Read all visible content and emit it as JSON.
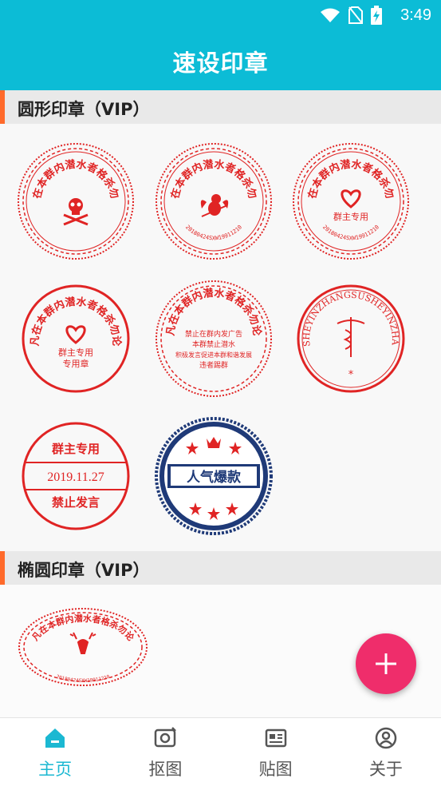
{
  "status_bar": {
    "time": "3:49"
  },
  "app_bar": {
    "title": "速设印章"
  },
  "sections": {
    "round": {
      "label": "圆形印章（VIP）"
    },
    "oval": {
      "label": "椭圆印章（VIP）"
    }
  },
  "stamps": {
    "s1": {
      "arc": "凡在本群内潜水者格杀勿论"
    },
    "s2": {
      "arc": "凡在本群内潜水者格杀勿论",
      "bottom": "20180424SXW19911210"
    },
    "s3": {
      "arc": "凡在本群内潜水者格杀勿论",
      "center": "群主专用",
      "bottom": "20180424SXW19911210"
    },
    "s4": {
      "arc": "凡在本群内潜水者格杀勿论",
      "line1": "群主专用",
      "line2": "专用章"
    },
    "s5": {
      "arc": "凡在本群内潜水者格杀勿论",
      "line1": "禁止在群内发广告",
      "line2": "本群禁止潜水",
      "line3": "积极发言促进本群和谐发展",
      "line4": "违者踢群"
    },
    "s6": {
      "arc": "SUSHEYINZHANGSUSHEYINZHANG",
      "star": "*"
    },
    "s7": {
      "top": "群主专用",
      "middle": "2019.11.27",
      "bottom": "禁止发言"
    },
    "s8": {
      "text": "人气爆款"
    },
    "s9": {
      "arc": "凡在本群内潜水者格杀勿论",
      "bottom": "20180424SXW19911210"
    }
  },
  "colors": {
    "primary": "#0cbcd6",
    "accent": "#ef2d6b",
    "stamp_red": "#e02424",
    "navy": "#1f3a78"
  },
  "nav": [
    {
      "label": "主页",
      "icon": "home-icon"
    },
    {
      "label": "抠图",
      "icon": "cutout-icon"
    },
    {
      "label": "贴图",
      "icon": "sticker-icon"
    },
    {
      "label": "关于",
      "icon": "profile-icon"
    }
  ]
}
